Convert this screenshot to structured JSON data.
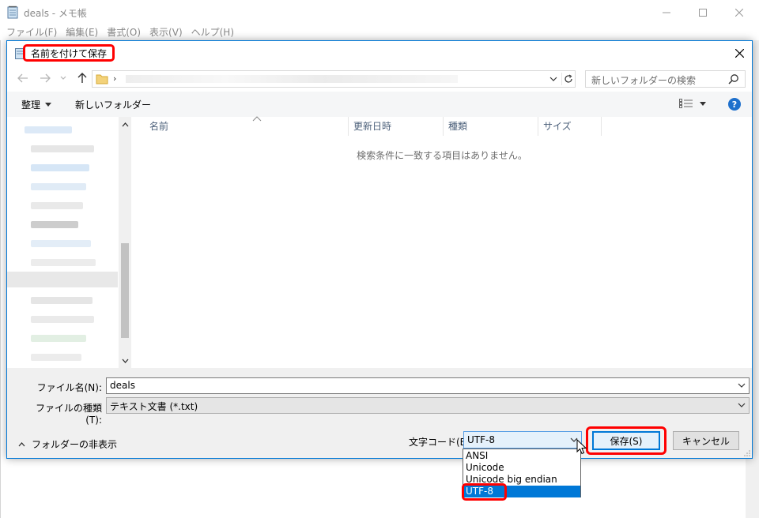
{
  "notepad": {
    "title": "deals - メモ帳",
    "menu": [
      {
        "label": "ファイル(F)"
      },
      {
        "label": "編集(E)"
      },
      {
        "label": "書式(O)"
      },
      {
        "label": "表示(V)"
      },
      {
        "label": "ヘルプ(H)"
      }
    ]
  },
  "dialog": {
    "title": "名前を付けて保存",
    "search_placeholder": "新しいフォルダーの検索",
    "toolbar": {
      "organize_label": "整理",
      "new_folder_label": "新しいフォルダー"
    },
    "columns": [
      {
        "label": "名前"
      },
      {
        "label": "更新日時"
      },
      {
        "label": "種類"
      },
      {
        "label": "サイズ"
      }
    ],
    "empty_message": "検索条件に一致する項目はありません。",
    "filename": {
      "label": "ファイル名(N):",
      "value": "deals"
    },
    "filetype": {
      "label": "ファイルの種類(T):",
      "value": "テキスト文書 (*.txt)"
    },
    "hide_folders_label": "フォルダーの非表示",
    "encoding": {
      "label": "文字コード(E):",
      "value": "UTF-8",
      "options": [
        "ANSI",
        "Unicode",
        "Unicode big endian",
        "UTF-8"
      ],
      "highlighted": "UTF-8"
    },
    "save_label": "保存(S)",
    "cancel_label": "キャンセル"
  },
  "colors": {
    "accent": "#0078d7",
    "highlight_frame": "#ff0000",
    "selection": "#0078d7"
  }
}
